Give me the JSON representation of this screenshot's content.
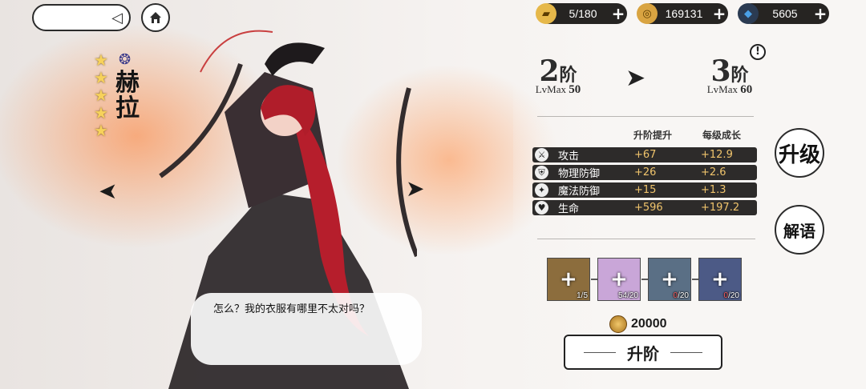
{
  "character": {
    "name": "赫拉",
    "stars": 5,
    "dialog": "怎么？我的衣服有哪里不太对吗？"
  },
  "resources": [
    {
      "icon": "stamina-book-icon",
      "value": "5/180",
      "color": "#e6b84a"
    },
    {
      "icon": "gold-coin-icon",
      "value": "169131",
      "color": "#d9a441"
    },
    {
      "icon": "blue-crystal-icon",
      "value": "5605",
      "color": "#4aa0e6"
    }
  ],
  "rank": {
    "current": {
      "num": "2",
      "label": "阶",
      "lv_prefix": "LvMax",
      "lv": "50"
    },
    "next": {
      "num": "3",
      "label": "阶",
      "lv_prefix": "LvMax",
      "lv": "60"
    },
    "alert": "!"
  },
  "stats": {
    "head_boost": "升阶提升",
    "head_growth": "每级成长",
    "rows": [
      {
        "icon": "sword-icon",
        "label": "攻击",
        "boost": "+67",
        "growth": "+12.9"
      },
      {
        "icon": "shield-icon",
        "label": "物理防御",
        "boost": "+26",
        "growth": "+2.6"
      },
      {
        "icon": "magic-shield-icon",
        "label": "魔法防御",
        "boost": "+15",
        "growth": "+1.3"
      },
      {
        "icon": "heart-icon",
        "label": "生命",
        "boost": "+596",
        "growth": "+197.2"
      }
    ]
  },
  "side_buttons": {
    "level_up": "升级",
    "interpret": "解语"
  },
  "materials": [
    {
      "have": "1",
      "need": "5",
      "bg": "#8c6d3d"
    },
    {
      "have": "54",
      "need": "20",
      "bg": "#c9a6d8"
    },
    {
      "have": "0",
      "need": "20",
      "bg": "#5a6f85"
    },
    {
      "have": "0",
      "need": "20",
      "bg": "#4c5a86"
    }
  ],
  "cost": "20000",
  "upgrade_button": "升阶"
}
